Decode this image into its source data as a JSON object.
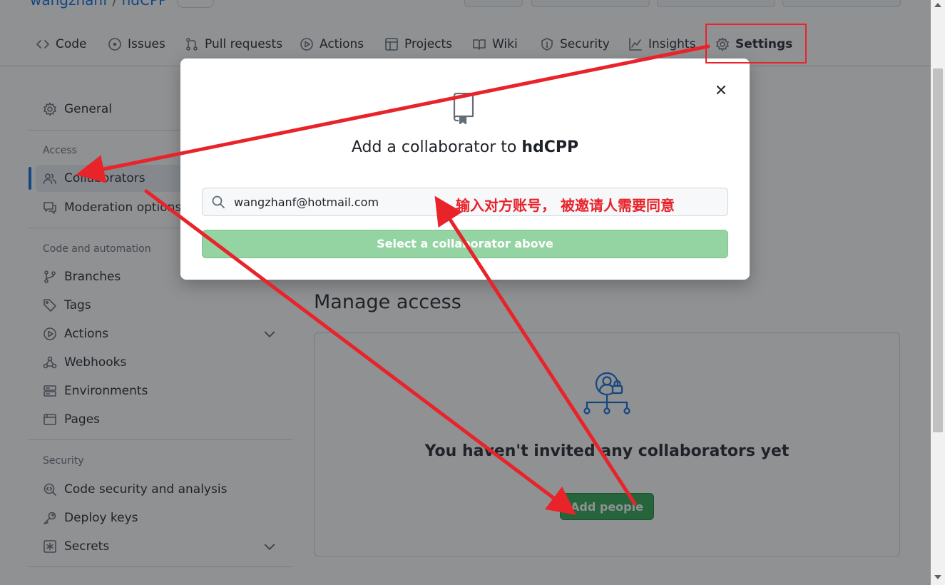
{
  "repo": {
    "owner": "wangzhanf",
    "separator": "/",
    "name": "hdCPP"
  },
  "tabs": [
    {
      "label": "Code",
      "icon": "code-icon"
    },
    {
      "label": "Issues",
      "icon": "issue-icon"
    },
    {
      "label": "Pull requests",
      "icon": "pull-request-icon"
    },
    {
      "label": "Actions",
      "icon": "play-icon"
    },
    {
      "label": "Projects",
      "icon": "table-icon"
    },
    {
      "label": "Wiki",
      "icon": "book-icon"
    },
    {
      "label": "Security",
      "icon": "shield-icon"
    },
    {
      "label": "Insights",
      "icon": "graph-icon"
    },
    {
      "label": "Settings",
      "icon": "gear-icon"
    }
  ],
  "sidebar": {
    "general": "General",
    "access_heading": "Access",
    "collaborators": "Collaborators",
    "moderation": "Moderation options",
    "code_automation_heading": "Code and automation",
    "branches": "Branches",
    "tags": "Tags",
    "actions": "Actions",
    "webhooks": "Webhooks",
    "environments": "Environments",
    "pages": "Pages",
    "security_heading": "Security",
    "code_security": "Code security and analysis",
    "deploy_keys": "Deploy keys",
    "secrets": "Secrets"
  },
  "main": {
    "title": "Manage access",
    "empty_message": "You haven't invited any collaborators yet",
    "add_people": "Add people"
  },
  "dialog": {
    "title_prefix": "Add a collaborator to ",
    "repo_name": "hdCPP",
    "search_value": "wangzhanf@hotmail.com",
    "select_button": "Select a collaborator above"
  },
  "annotation": {
    "text": "输入对方账号， 被邀请人需要同意",
    "color": "#e8232a"
  },
  "colors": {
    "accent": "#0969da",
    "success": "#2da44e",
    "annotation": "#e8232a"
  }
}
